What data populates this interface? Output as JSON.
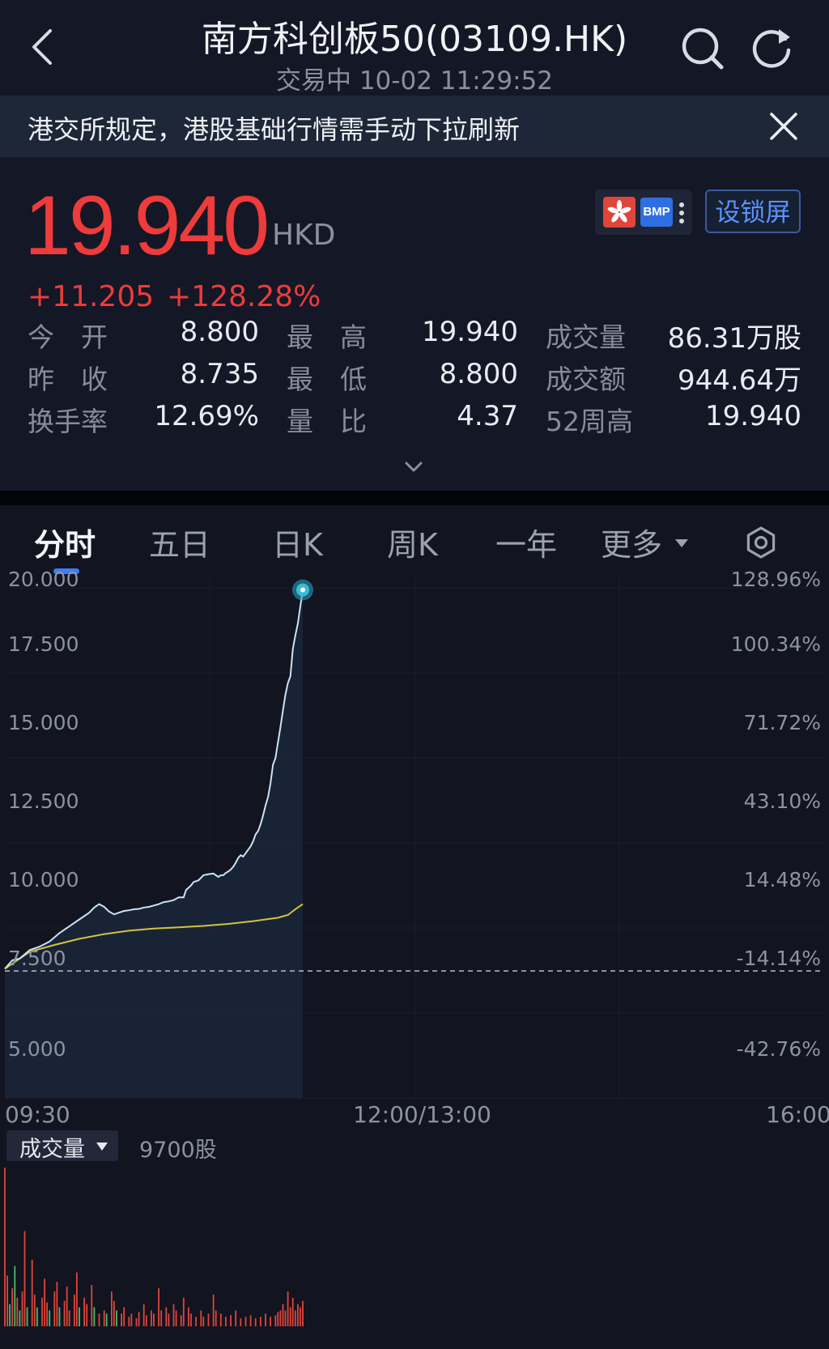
{
  "header": {
    "title": "南方科创板50(03109.HK)",
    "subtitle": "交易中 10-02 11:29:52"
  },
  "notice": {
    "text": "港交所规定，港股基础行情需手动下拉刷新"
  },
  "quote": {
    "price": "19.940",
    "currency": "HKD",
    "change": "+11.205",
    "change_pct": "+128.28%",
    "badge_bmp": "BMP",
    "lock_screen": "设锁屏",
    "stats": [
      {
        "label": "今　开",
        "value": "8.800"
      },
      {
        "label": "最　高",
        "value": "19.940"
      },
      {
        "label": "成交量",
        "value": "86.31万股"
      },
      {
        "label": "昨　收",
        "value": "8.735"
      },
      {
        "label": "最　低",
        "value": "8.800"
      },
      {
        "label": "成交额",
        "value": "944.64万"
      },
      {
        "label": "换手率",
        "value": "12.69%"
      },
      {
        "label": "量　比",
        "value": "4.37"
      },
      {
        "label": "52周高",
        "value": "19.940"
      }
    ]
  },
  "tabs": [
    "分时",
    "五日",
    "日K",
    "周K",
    "一年",
    "更多"
  ],
  "colors": {
    "up": "#ee3b3b",
    "accent": "#3f7cf5",
    "price_line": "#c9e4f4",
    "avg_line": "#d4c43a",
    "vol_up": "#e0453a",
    "vol_down": "#3fbf6a"
  },
  "chart_data": {
    "type": "line",
    "title": "",
    "y_labels_left": [
      "20.000",
      "17.500",
      "15.000",
      "12.500",
      "10.000",
      "7.500",
      "5.000"
    ],
    "y_labels_right": [
      "128.96%",
      "100.34%",
      "71.72%",
      "43.10%",
      "14.48%",
      "-14.14%",
      "-42.76%"
    ],
    "x_labels": [
      "09:30",
      "12:00/13:00",
      "16:00"
    ],
    "ylim": [
      5.0,
      20.0
    ],
    "prev_close": 8.735,
    "session_minutes": 330,
    "series": [
      {
        "x": [
          0,
          3,
          6,
          10,
          14,
          18,
          22,
          26,
          30,
          34,
          36,
          38,
          40,
          42,
          44,
          46,
          48,
          50,
          52,
          54,
          56,
          58,
          60,
          62,
          64,
          66,
          68,
          70,
          72,
          73,
          74,
          75,
          76,
          78,
          80,
          82,
          84,
          86,
          87,
          88,
          89,
          90,
          91,
          92,
          93,
          94,
          95,
          96,
          97,
          98,
          99,
          100,
          101,
          102,
          103,
          104,
          105,
          106,
          107,
          108,
          109,
          110,
          111,
          112,
          113,
          114,
          115,
          116,
          117,
          118,
          119,
          120
        ],
        "values": [
          8.8,
          9.05,
          9.1,
          9.35,
          9.45,
          9.6,
          9.85,
          10.05,
          10.25,
          10.45,
          10.6,
          10.7,
          10.62,
          10.48,
          10.4,
          10.45,
          10.5,
          10.52,
          10.55,
          10.56,
          10.6,
          10.62,
          10.66,
          10.7,
          10.76,
          10.78,
          10.82,
          10.9,
          10.9,
          11.12,
          11.18,
          11.25,
          11.35,
          11.4,
          11.55,
          11.58,
          11.6,
          11.5,
          11.55,
          11.55,
          11.62,
          11.66,
          11.72,
          11.8,
          11.92,
          12.06,
          12.14,
          12.1,
          12.2,
          12.3,
          12.4,
          12.55,
          12.75,
          12.85,
          13.05,
          13.3,
          13.6,
          13.85,
          14.25,
          14.8,
          15.0,
          15.45,
          15.9,
          16.4,
          16.85,
          17.2,
          17.4,
          18.2,
          18.6,
          18.95,
          19.45,
          19.94
        ]
      },
      {
        "x": [
          0,
          10,
          20,
          30,
          40,
          50,
          60,
          70,
          80,
          90,
          100,
          110,
          114,
          117,
          120
        ],
        "values": [
          8.8,
          9.3,
          9.5,
          9.68,
          9.82,
          9.92,
          9.98,
          10.02,
          10.06,
          10.12,
          10.2,
          10.3,
          10.38,
          10.55,
          10.7
        ]
      }
    ],
    "volume": {
      "label": "成交量",
      "value": "9700股",
      "bars": [
        {
          "x": 0,
          "h": 1.0,
          "c": "up"
        },
        {
          "x": 1,
          "h": 0.32,
          "c": "up"
        },
        {
          "x": 2,
          "h": 0.14,
          "c": "down"
        },
        {
          "x": 3,
          "h": 0.24,
          "c": "up"
        },
        {
          "x": 4,
          "h": 0.38,
          "c": "down"
        },
        {
          "x": 5,
          "h": 0.18,
          "c": "up"
        },
        {
          "x": 6,
          "h": 0.1,
          "c": "down"
        },
        {
          "x": 7,
          "h": 0.22,
          "c": "up"
        },
        {
          "x": 8,
          "h": 0.6,
          "c": "up"
        },
        {
          "x": 9,
          "h": 0.12,
          "c": "down"
        },
        {
          "x": 11,
          "h": 0.42,
          "c": "up"
        },
        {
          "x": 12,
          "h": 0.2,
          "c": "up"
        },
        {
          "x": 13,
          "h": 0.12,
          "c": "down"
        },
        {
          "x": 15,
          "h": 0.18,
          "c": "up"
        },
        {
          "x": 16,
          "h": 0.3,
          "c": "up"
        },
        {
          "x": 17,
          "h": 0.15,
          "c": "up"
        },
        {
          "x": 18,
          "h": 0.1,
          "c": "down"
        },
        {
          "x": 20,
          "h": 0.22,
          "c": "up"
        },
        {
          "x": 21,
          "h": 0.28,
          "c": "up"
        },
        {
          "x": 22,
          "h": 0.12,
          "c": "down"
        },
        {
          "x": 24,
          "h": 0.16,
          "c": "up"
        },
        {
          "x": 25,
          "h": 0.25,
          "c": "up"
        },
        {
          "x": 26,
          "h": 0.1,
          "c": "up"
        },
        {
          "x": 28,
          "h": 0.2,
          "c": "up"
        },
        {
          "x": 29,
          "h": 0.34,
          "c": "up"
        },
        {
          "x": 30,
          "h": 0.12,
          "c": "down"
        },
        {
          "x": 32,
          "h": 0.18,
          "c": "up"
        },
        {
          "x": 33,
          "h": 0.14,
          "c": "up"
        },
        {
          "x": 35,
          "h": 0.26,
          "c": "up"
        },
        {
          "x": 36,
          "h": 0.12,
          "c": "down"
        },
        {
          "x": 38,
          "h": 0.08,
          "c": "up"
        },
        {
          "x": 40,
          "h": 0.1,
          "c": "up"
        },
        {
          "x": 41,
          "h": 0.08,
          "c": "down"
        },
        {
          "x": 43,
          "h": 0.22,
          "c": "up"
        },
        {
          "x": 44,
          "h": 0.16,
          "c": "up"
        },
        {
          "x": 45,
          "h": 0.1,
          "c": "down"
        },
        {
          "x": 47,
          "h": 0.08,
          "c": "up"
        },
        {
          "x": 48,
          "h": 0.12,
          "c": "up"
        },
        {
          "x": 50,
          "h": 0.06,
          "c": "up"
        },
        {
          "x": 51,
          "h": 0.08,
          "c": "up"
        },
        {
          "x": 53,
          "h": 0.05,
          "c": "up"
        },
        {
          "x": 54,
          "h": 0.09,
          "c": "up"
        },
        {
          "x": 56,
          "h": 0.14,
          "c": "up"
        },
        {
          "x": 57,
          "h": 0.07,
          "c": "up"
        },
        {
          "x": 59,
          "h": 0.1,
          "c": "up"
        },
        {
          "x": 60,
          "h": 0.08,
          "c": "up"
        },
        {
          "x": 62,
          "h": 0.24,
          "c": "up"
        },
        {
          "x": 63,
          "h": 0.1,
          "c": "up"
        },
        {
          "x": 65,
          "h": 0.12,
          "c": "up"
        },
        {
          "x": 66,
          "h": 0.08,
          "c": "up"
        },
        {
          "x": 68,
          "h": 0.14,
          "c": "up"
        },
        {
          "x": 69,
          "h": 0.1,
          "c": "up"
        },
        {
          "x": 71,
          "h": 0.07,
          "c": "up"
        },
        {
          "x": 72,
          "h": 0.18,
          "c": "up"
        },
        {
          "x": 74,
          "h": 0.12,
          "c": "up"
        },
        {
          "x": 75,
          "h": 0.08,
          "c": "up"
        },
        {
          "x": 77,
          "h": 0.06,
          "c": "up"
        },
        {
          "x": 79,
          "h": 0.1,
          "c": "up"
        },
        {
          "x": 80,
          "h": 0.06,
          "c": "up"
        },
        {
          "x": 82,
          "h": 0.08,
          "c": "up"
        },
        {
          "x": 84,
          "h": 0.2,
          "c": "up"
        },
        {
          "x": 85,
          "h": 0.1,
          "c": "up"
        },
        {
          "x": 87,
          "h": 0.08,
          "c": "up"
        },
        {
          "x": 89,
          "h": 0.06,
          "c": "up"
        },
        {
          "x": 91,
          "h": 0.07,
          "c": "up"
        },
        {
          "x": 93,
          "h": 0.1,
          "c": "up"
        },
        {
          "x": 95,
          "h": 0.05,
          "c": "up"
        },
        {
          "x": 97,
          "h": 0.06,
          "c": "up"
        },
        {
          "x": 99,
          "h": 0.07,
          "c": "up"
        },
        {
          "x": 101,
          "h": 0.05,
          "c": "up"
        },
        {
          "x": 103,
          "h": 0.06,
          "c": "up"
        },
        {
          "x": 105,
          "h": 0.08,
          "c": "up"
        },
        {
          "x": 107,
          "h": 0.06,
          "c": "up"
        },
        {
          "x": 109,
          "h": 0.07,
          "c": "up"
        },
        {
          "x": 110,
          "h": 0.09,
          "c": "up"
        },
        {
          "x": 111,
          "h": 0.1,
          "c": "up"
        },
        {
          "x": 112,
          "h": 0.14,
          "c": "up"
        },
        {
          "x": 113,
          "h": 0.1,
          "c": "up"
        },
        {
          "x": 114,
          "h": 0.22,
          "c": "up"
        },
        {
          "x": 115,
          "h": 0.12,
          "c": "up"
        },
        {
          "x": 116,
          "h": 0.18,
          "c": "up"
        },
        {
          "x": 117,
          "h": 0.1,
          "c": "up"
        },
        {
          "x": 118,
          "h": 0.14,
          "c": "up"
        },
        {
          "x": 119,
          "h": 0.12,
          "c": "up"
        },
        {
          "x": 120,
          "h": 0.16,
          "c": "up"
        }
      ]
    }
  }
}
